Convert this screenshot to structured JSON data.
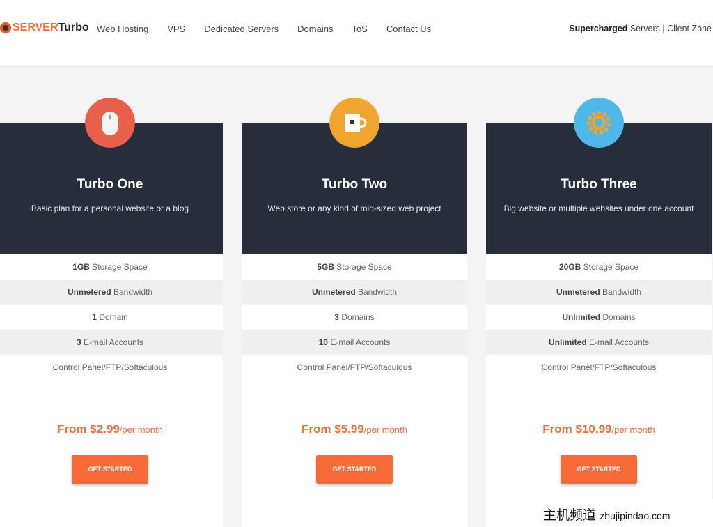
{
  "brand": {
    "part1": "SERVER",
    "part2": "Turbo"
  },
  "nav": [
    "Web Hosting",
    "VPS",
    "Dedicated Servers",
    "Domains",
    "ToS",
    "Contact Us"
  ],
  "header_right": {
    "bold": "Supercharged",
    "rest": " Servers | Client Zone"
  },
  "plans": [
    {
      "name": "Turbo One",
      "desc": "Basic plan for a personal website or a blog",
      "icon": "mouse-icon",
      "color": "#e8604c",
      "features": [
        [
          "1GB",
          " Storage Space"
        ],
        [
          "Unmetered",
          " Bandwidth"
        ],
        [
          "1",
          " Domain"
        ],
        [
          "3",
          " E-mail Accounts"
        ],
        [
          "",
          "Control Panel/FTP/Softaculous"
        ]
      ],
      "price_from": "From $2.99",
      "price_unit": "/per month",
      "button": "GET STARTED"
    },
    {
      "name": "Turbo Two",
      "desc": "Web store or any kind of mid-sized web project",
      "icon": "mug-icon",
      "color": "#f0a531",
      "features": [
        [
          "5GB",
          " Storage Space"
        ],
        [
          "Unmetered",
          " Bandwidth"
        ],
        [
          "3",
          " Domains"
        ],
        [
          "10",
          " E-mail Accounts"
        ],
        [
          "",
          "Control Panel/FTP/Softaculous"
        ]
      ],
      "price_from": "From $5.99",
      "price_unit": "/per month",
      "button": "GET STARTED"
    },
    {
      "name": "Turbo Three",
      "desc": "Big website or multiple websites under one account",
      "icon": "gear-icon",
      "color": "#4fb8e8",
      "features": [
        [
          "20GB",
          " Storage Space"
        ],
        [
          "Unmetered",
          " Bandwidth"
        ],
        [
          "Unlimited",
          " Domains"
        ],
        [
          "Unlimited",
          " E-mail Accounts"
        ],
        [
          "",
          "Control Panel/FTP/Softaculous"
        ]
      ],
      "price_from": "From $10.99",
      "price_unit": "/per month",
      "button": "GET STARTED"
    }
  ],
  "watermark": {
    "cn": "主机频道",
    "url": "zhujipindao.com"
  }
}
